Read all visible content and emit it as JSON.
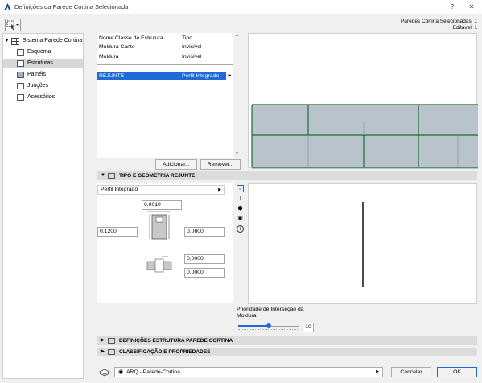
{
  "window": {
    "title": "Definições da Parede Cortina Selecionada",
    "help": "?",
    "close": "✕"
  },
  "selection_info": {
    "line1": "Paredes Cortina Selecionadas: 1",
    "line2": "Editável: 1"
  },
  "sidebar": {
    "root": "Sistema Parede Cortina",
    "items": [
      {
        "label": "Esquema"
      },
      {
        "label": "Estruturas"
      },
      {
        "label": "Painéis"
      },
      {
        "label": "Junções"
      },
      {
        "label": "Acessórios"
      }
    ]
  },
  "list": {
    "header": {
      "col1": "Nome Classe de Estrutura",
      "col2": "Tipo"
    },
    "rows": [
      {
        "name": "Moldura Canto",
        "type": "Invisível"
      },
      {
        "name": "Moldura",
        "type": "Invisível"
      },
      {
        "name": "REJUNTE",
        "type": "Perfil Integrado"
      }
    ],
    "add_button": "Adicionar...",
    "remove_button": "Remover..."
  },
  "section_type": {
    "label": "TIPO E GEOMETRIA REJUNTE"
  },
  "geometry": {
    "type_dropdown": "Perfil Integrado",
    "top_field": "0,0010",
    "left_field": "0,1200",
    "right_field": "0,0600",
    "offset1": "0,0000",
    "offset2": "0,0000"
  },
  "priority": {
    "label": "Prioridade de Interseção da Moldura:",
    "value": "10",
    "level": 0.5
  },
  "sections": [
    {
      "label": "DEFINIÇÕES ESTRUTURA PAREDE CORTINA"
    },
    {
      "label": "CLASSIFICAÇÃO E PROPRIEDADES"
    }
  ],
  "footer": {
    "layer": "ARQ - Parede-Cortina",
    "cancel": "Cancelar",
    "ok": "OK"
  },
  "colors": {
    "accent": "#1e6ad6",
    "glass": "#b9c3cc",
    "frame": "#1c6b2c"
  }
}
